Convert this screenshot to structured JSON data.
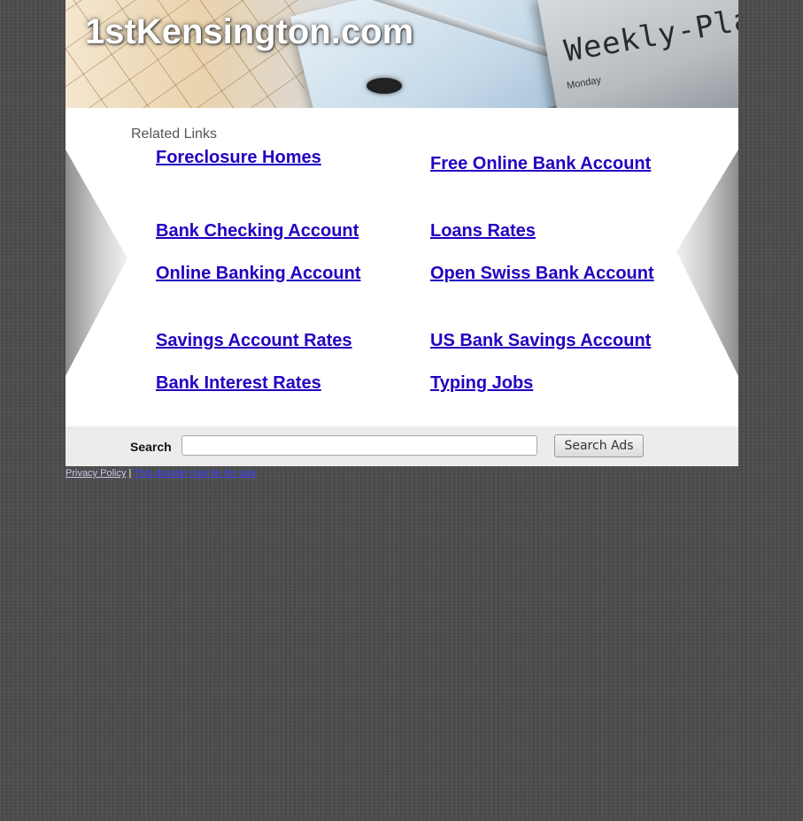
{
  "header": {
    "site_title": "1stKensington.com",
    "banner_text": "Weekly-Plan",
    "banner_day": "Monday"
  },
  "related": {
    "title": "Related Links",
    "links": [
      {
        "label": "Foreclosure Homes"
      },
      {
        "label": "Free Online Bank Account"
      },
      {
        "label": "Bank Checking Account"
      },
      {
        "label": "Loans Rates"
      },
      {
        "label": "Online Banking Account"
      },
      {
        "label": "Open Swiss Bank Account"
      },
      {
        "label": "Savings Account Rates"
      },
      {
        "label": "US Bank Savings Account"
      },
      {
        "label": "Bank Interest Rates"
      },
      {
        "label": "Typing Jobs"
      }
    ]
  },
  "search": {
    "label": "Search",
    "value": "",
    "placeholder": "",
    "button_label": "Search Ads"
  },
  "footer": {
    "privacy_label": "Privacy Policy",
    "separator": "|",
    "sale_label": "This domain may be for sale"
  },
  "colors": {
    "link": "#2200c1",
    "background": "#4a4a4a",
    "content_bg": "#ffffff",
    "searchbar_bg": "#ececec"
  }
}
